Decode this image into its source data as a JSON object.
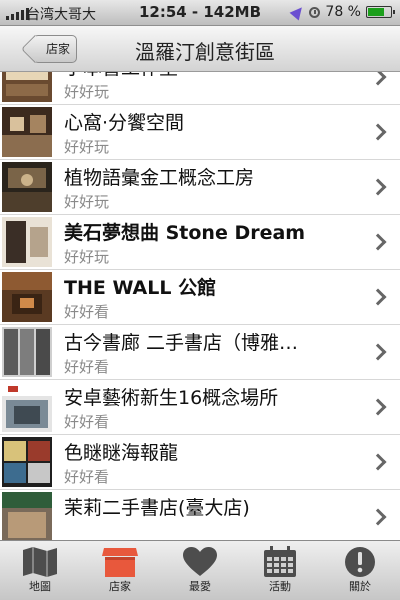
{
  "status_bar": {
    "carrier": "台湾大哥大",
    "time": "12:54 - 142MB",
    "battery": "78 %",
    "battery_level": 0.78
  },
  "nav": {
    "back_label": "店家",
    "title": "溫羅汀創意街區"
  },
  "list": {
    "items": [
      {
        "title": "小本書工作室",
        "subtitle": "好好玩"
      },
      {
        "title": "心窩·分饗空間",
        "subtitle": "好好玩"
      },
      {
        "title": "植物語彙金工概念工房",
        "subtitle": "好好玩"
      },
      {
        "title": "美石夢想曲 Stone Dream",
        "subtitle": "好好玩"
      },
      {
        "title": "THE WALL 公館",
        "subtitle": "好好看"
      },
      {
        "title": "古今書廊 二手書店（博雅…",
        "subtitle": "好好看"
      },
      {
        "title": "安卓藝術新生16概念場所",
        "subtitle": "好好看"
      },
      {
        "title": "色瞇瞇海報龍",
        "subtitle": "好好看"
      },
      {
        "title": "茉莉二手書店(臺大店)",
        "subtitle": ""
      }
    ]
  },
  "tabbar": {
    "tabs": [
      {
        "label": "地圖",
        "icon": "map-icon"
      },
      {
        "label": "店家",
        "icon": "store-icon"
      },
      {
        "label": "最愛",
        "icon": "heart-icon"
      },
      {
        "label": "活動",
        "icon": "calendar-icon"
      },
      {
        "label": "關於",
        "icon": "info-icon"
      }
    ],
    "active_index": 1,
    "active_color": "#e8583c"
  }
}
